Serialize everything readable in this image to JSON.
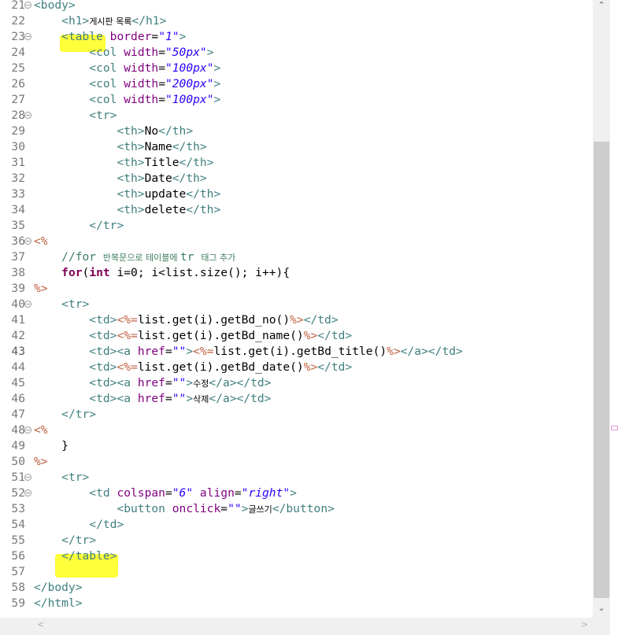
{
  "editor": {
    "current_line": 43,
    "lines": [
      {
        "n": "21",
        "fold": true,
        "segs": [
          [
            "tag",
            "<body>"
          ]
        ]
      },
      {
        "n": "22",
        "segs": [
          [
            "tx",
            "    "
          ],
          [
            "tag",
            "<h1>"
          ],
          [
            "tx kr",
            "게시판 목록"
          ],
          [
            "tag",
            "</h1>"
          ]
        ]
      },
      {
        "n": "23",
        "fold": true,
        "segs": [
          [
            "tx",
            "    "
          ],
          [
            "tag",
            "<table"
          ],
          [
            "tx",
            " "
          ],
          [
            "at",
            "border"
          ],
          [
            "tx",
            "="
          ],
          [
            "val",
            "\"1\""
          ],
          [
            "tag",
            ">"
          ]
        ]
      },
      {
        "n": "24",
        "segs": [
          [
            "tx",
            "        "
          ],
          [
            "tag",
            "<col"
          ],
          [
            "tx",
            " "
          ],
          [
            "at",
            "width"
          ],
          [
            "tx",
            "="
          ],
          [
            "val",
            "\"50px\""
          ],
          [
            "tag",
            ">"
          ]
        ]
      },
      {
        "n": "25",
        "segs": [
          [
            "tx",
            "        "
          ],
          [
            "tag",
            "<col"
          ],
          [
            "tx",
            " "
          ],
          [
            "at",
            "width"
          ],
          [
            "tx",
            "="
          ],
          [
            "val",
            "\"100px\""
          ],
          [
            "tag",
            ">"
          ]
        ]
      },
      {
        "n": "26",
        "segs": [
          [
            "tx",
            "        "
          ],
          [
            "tag",
            "<col"
          ],
          [
            "tx",
            " "
          ],
          [
            "at",
            "width"
          ],
          [
            "tx",
            "="
          ],
          [
            "val",
            "\"200px\""
          ],
          [
            "tag",
            ">"
          ]
        ]
      },
      {
        "n": "27",
        "segs": [
          [
            "tx",
            "        "
          ],
          [
            "tag",
            "<col"
          ],
          [
            "tx",
            " "
          ],
          [
            "at",
            "width"
          ],
          [
            "tx",
            "="
          ],
          [
            "val",
            "\"100px\""
          ],
          [
            "tag",
            ">"
          ]
        ]
      },
      {
        "n": "28",
        "fold": true,
        "segs": [
          [
            "tx",
            "        "
          ],
          [
            "tag",
            "<tr>"
          ]
        ]
      },
      {
        "n": "29",
        "segs": [
          [
            "tx",
            "            "
          ],
          [
            "tag",
            "<th>"
          ],
          [
            "tx",
            "No"
          ],
          [
            "tag",
            "</th>"
          ]
        ]
      },
      {
        "n": "30",
        "segs": [
          [
            "tx",
            "            "
          ],
          [
            "tag",
            "<th>"
          ],
          [
            "tx",
            "Name"
          ],
          [
            "tag",
            "</th>"
          ]
        ]
      },
      {
        "n": "31",
        "segs": [
          [
            "tx",
            "            "
          ],
          [
            "tag",
            "<th>"
          ],
          [
            "tx",
            "Title"
          ],
          [
            "tag",
            "</th>"
          ]
        ]
      },
      {
        "n": "32",
        "segs": [
          [
            "tx",
            "            "
          ],
          [
            "tag",
            "<th>"
          ],
          [
            "tx",
            "Date"
          ],
          [
            "tag",
            "</th>"
          ]
        ]
      },
      {
        "n": "33",
        "segs": [
          [
            "tx",
            "            "
          ],
          [
            "tag",
            "<th>"
          ],
          [
            "tx",
            "update"
          ],
          [
            "tag",
            "</th>"
          ]
        ]
      },
      {
        "n": "34",
        "segs": [
          [
            "tx",
            "            "
          ],
          [
            "tag",
            "<th>"
          ],
          [
            "tx",
            "delete"
          ],
          [
            "tag",
            "</th>"
          ]
        ]
      },
      {
        "n": "35",
        "segs": [
          [
            "tx",
            "        "
          ],
          [
            "tag",
            "</tr>"
          ]
        ]
      },
      {
        "n": "36",
        "fold": true,
        "segs": [
          [
            "jsp",
            "<%"
          ]
        ]
      },
      {
        "n": "37",
        "segs": [
          [
            "tx",
            "    "
          ],
          [
            "cm",
            "//for "
          ],
          [
            "cm kr",
            "반복문으로 테이블에 "
          ],
          [
            "cm",
            "tr "
          ],
          [
            "cm kr",
            "태그 추가"
          ]
        ]
      },
      {
        "n": "38",
        "segs": [
          [
            "tx",
            "    "
          ],
          [
            "kw",
            "for"
          ],
          [
            "tx",
            "("
          ],
          [
            "kw",
            "int"
          ],
          [
            "tx",
            " i=0; i<list.size(); i++){"
          ]
        ]
      },
      {
        "n": "39",
        "segs": [
          [
            "jsp",
            "%>"
          ]
        ]
      },
      {
        "n": "40",
        "fold": true,
        "segs": [
          [
            "tx",
            "    "
          ],
          [
            "tag",
            "<tr>"
          ]
        ]
      },
      {
        "n": "41",
        "segs": [
          [
            "tx",
            "        "
          ],
          [
            "tag",
            "<td>"
          ],
          [
            "jsp",
            "<%="
          ],
          [
            "tx",
            "list.get(i).getBd_no()"
          ],
          [
            "jsp",
            "%>"
          ],
          [
            "tag",
            "</td>"
          ]
        ]
      },
      {
        "n": "42",
        "segs": [
          [
            "tx",
            "        "
          ],
          [
            "tag",
            "<td>"
          ],
          [
            "jsp",
            "<%="
          ],
          [
            "tx",
            "list.get(i).getBd_name()"
          ],
          [
            "jsp",
            "%>"
          ],
          [
            "tag",
            "</td>"
          ]
        ]
      },
      {
        "n": "43",
        "segs": [
          [
            "tx",
            "        "
          ],
          [
            "tag",
            "<td><a"
          ],
          [
            "tx",
            " "
          ],
          [
            "at",
            "href"
          ],
          [
            "tx",
            "="
          ],
          [
            "val",
            "\"\""
          ],
          [
            "tag",
            ">"
          ],
          [
            "jsp",
            "<%="
          ],
          [
            "tx",
            "list.get(i).getBd_title()"
          ],
          [
            "jsp",
            "%>"
          ],
          [
            "tag",
            "</a></td>"
          ]
        ]
      },
      {
        "n": "44",
        "segs": [
          [
            "tx",
            "        "
          ],
          [
            "tag",
            "<td>"
          ],
          [
            "jsp",
            "<%="
          ],
          [
            "tx",
            "list.get(i).getBd_date()"
          ],
          [
            "jsp",
            "%>"
          ],
          [
            "tag",
            "</td>"
          ]
        ]
      },
      {
        "n": "45",
        "segs": [
          [
            "tx",
            "        "
          ],
          [
            "tag",
            "<td><a"
          ],
          [
            "tx",
            " "
          ],
          [
            "at",
            "href"
          ],
          [
            "tx",
            "="
          ],
          [
            "val",
            "\"\""
          ],
          [
            "tag",
            ">"
          ],
          [
            "tx kr",
            "수정"
          ],
          [
            "tag",
            "</a></td>"
          ]
        ]
      },
      {
        "n": "46",
        "segs": [
          [
            "tx",
            "        "
          ],
          [
            "tag",
            "<td><a"
          ],
          [
            "tx",
            " "
          ],
          [
            "at",
            "href"
          ],
          [
            "tx",
            "="
          ],
          [
            "val",
            "\"\""
          ],
          [
            "tag",
            ">"
          ],
          [
            "tx kr",
            "삭제"
          ],
          [
            "tag",
            "</a></td>"
          ]
        ]
      },
      {
        "n": "47",
        "segs": [
          [
            "tx",
            "    "
          ],
          [
            "tag",
            "</tr>"
          ]
        ]
      },
      {
        "n": "48",
        "fold": true,
        "segs": [
          [
            "jsp",
            "<%"
          ]
        ]
      },
      {
        "n": "49",
        "segs": [
          [
            "tx",
            "    }"
          ]
        ]
      },
      {
        "n": "50",
        "segs": [
          [
            "jsp",
            "%>"
          ]
        ]
      },
      {
        "n": "51",
        "fold": true,
        "segs": [
          [
            "tx",
            "    "
          ],
          [
            "tag",
            "<tr>"
          ]
        ]
      },
      {
        "n": "52",
        "fold": true,
        "segs": [
          [
            "tx",
            "        "
          ],
          [
            "tag",
            "<td"
          ],
          [
            "tx",
            " "
          ],
          [
            "at",
            "colspan"
          ],
          [
            "tx",
            "="
          ],
          [
            "val",
            "\"6\""
          ],
          [
            "tx",
            " "
          ],
          [
            "at",
            "align"
          ],
          [
            "tx",
            "="
          ],
          [
            "val",
            "\"right\""
          ],
          [
            "tag",
            ">"
          ]
        ]
      },
      {
        "n": "53",
        "segs": [
          [
            "tx",
            "            "
          ],
          [
            "tag",
            "<button"
          ],
          [
            "tx",
            " "
          ],
          [
            "at",
            "onclick"
          ],
          [
            "tx",
            "="
          ],
          [
            "val",
            "\"\""
          ],
          [
            "tag",
            ">"
          ],
          [
            "tx kr",
            "글쓰기"
          ],
          [
            "tag",
            "</button>"
          ]
        ]
      },
      {
        "n": "54",
        "segs": [
          [
            "tx",
            "        "
          ],
          [
            "tag",
            "</td>"
          ]
        ]
      },
      {
        "n": "55",
        "segs": [
          [
            "tx",
            "    "
          ],
          [
            "tag",
            "</tr>"
          ]
        ]
      },
      {
        "n": "56",
        "segs": [
          [
            "tx",
            "    "
          ],
          [
            "tag",
            "</table>"
          ]
        ]
      },
      {
        "n": "57",
        "segs": []
      },
      {
        "n": "58",
        "segs": [
          [
            "tag",
            "</body>"
          ]
        ]
      },
      {
        "n": "59",
        "segs": [
          [
            "tag",
            "</html>"
          ]
        ]
      }
    ]
  },
  "colors": {
    "highlight": "#ffff3a",
    "tag": "#3f7f7f",
    "attribute": "#7f007f",
    "value": "#2a00ff",
    "jsp": "#bf5f3f",
    "keyword": "#7f0055",
    "comment": "#3f7f5f"
  },
  "scrollbar": {
    "up": "⌃",
    "down": "⌄",
    "left": "<",
    "right": ">"
  }
}
